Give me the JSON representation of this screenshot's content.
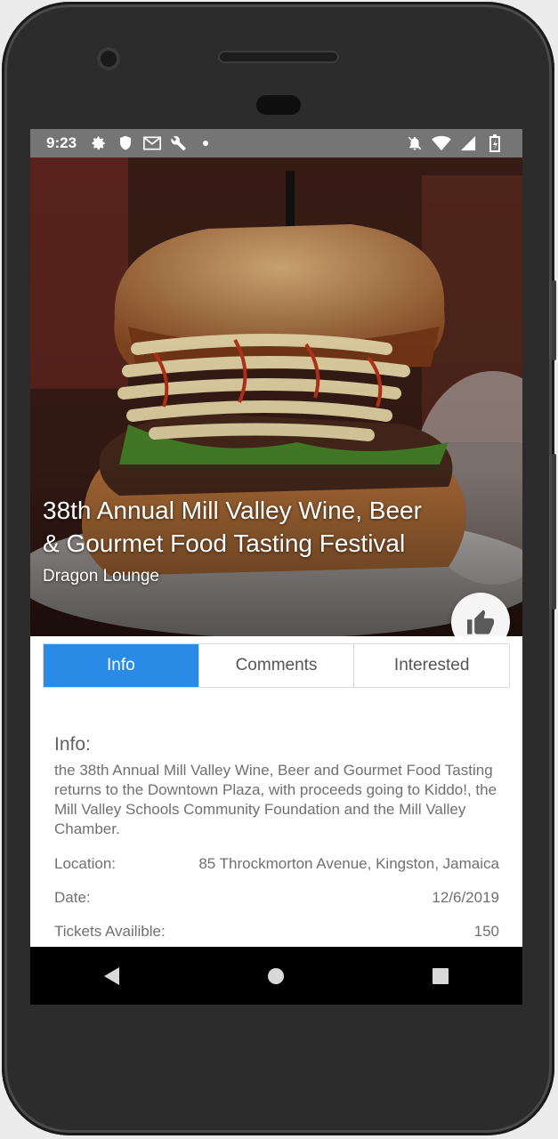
{
  "status_bar": {
    "time": "9:23",
    "left_icons": [
      "gear-icon",
      "shield-icon",
      "mail-icon",
      "wrench-icon",
      "dot-icon"
    ],
    "right_icons": [
      "mute-icon",
      "wifi-icon",
      "signal-icon",
      "battery-icon"
    ]
  },
  "event": {
    "title": "38th Annual Mill Valley Wine, Beer & Gourmet Food Tasting Festival",
    "venue": "Dragon Lounge",
    "like_icon": "thumbs-up-icon"
  },
  "tabs": [
    {
      "label": "Info",
      "active": true
    },
    {
      "label": "Comments",
      "active": false
    },
    {
      "label": "Interested",
      "active": false
    }
  ],
  "info": {
    "heading": "Info:",
    "description": "the 38th Annual Mill Valley Wine, Beer and Gourmet Food Tasting returns to the Downtown Plaza, with proceeds going to Kiddo!, the Mill Valley Schools Community Foundation and the Mill Valley Chamber.",
    "location_label": "Location:",
    "location_value": "85 Throckmorton Avenue, Kingston, Jamaica",
    "date_label": "Date:",
    "date_value": "12/6/2019",
    "tickets_label": "Tickets Availible:",
    "tickets_value": "150"
  },
  "nav": [
    "back-icon",
    "home-icon",
    "recents-icon"
  ],
  "colors": {
    "accent": "#2a8be6",
    "status_bar": "#757575",
    "nav_bar": "#000000"
  }
}
